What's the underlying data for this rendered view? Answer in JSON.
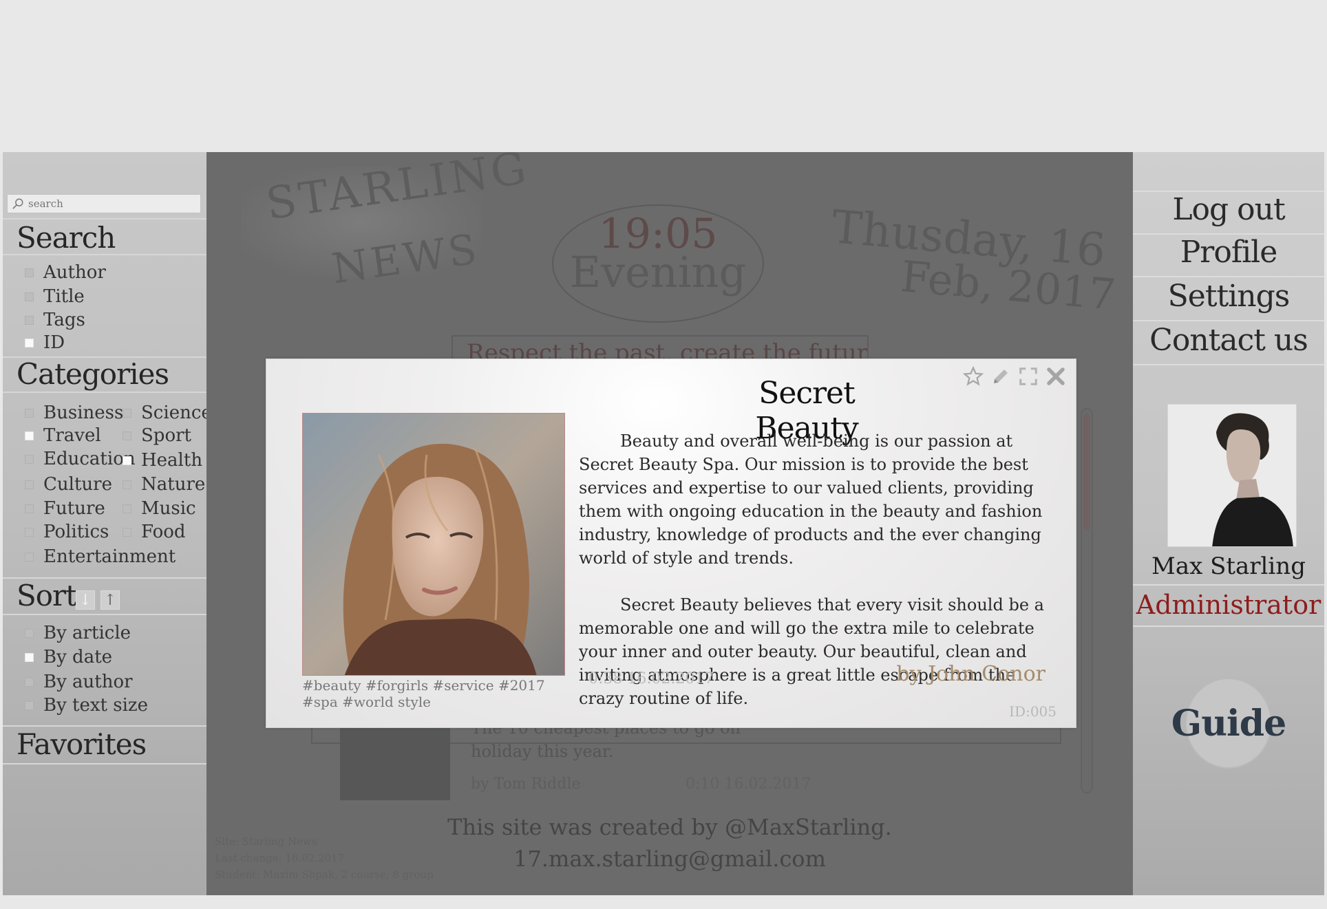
{
  "search": {
    "placeholder": "search"
  },
  "sidebar": {
    "search_title": "Search",
    "search_options": [
      {
        "label": "Author",
        "checked": false
      },
      {
        "label": "Title",
        "checked": false
      },
      {
        "label": "Tags",
        "checked": false
      },
      {
        "label": "ID",
        "checked": true
      }
    ],
    "categories_title": "Categories",
    "categories_left": [
      {
        "label": "Business",
        "checked": false
      },
      {
        "label": "Travel",
        "checked": true
      },
      {
        "label": "Education",
        "checked": false
      },
      {
        "label": "Culture",
        "checked": false
      },
      {
        "label": "Future",
        "checked": false
      },
      {
        "label": "Politics",
        "checked": false
      },
      {
        "label": "Entertainment",
        "checked": false
      }
    ],
    "categories_right": [
      {
        "label": "Science",
        "checked": false
      },
      {
        "label": "Sport",
        "checked": false
      },
      {
        "label": "Health",
        "checked": true
      },
      {
        "label": "Nature",
        "checked": false
      },
      {
        "label": "Music",
        "checked": false
      },
      {
        "label": "Food",
        "checked": false
      }
    ],
    "sort_title": "Sort",
    "sort_options": [
      {
        "label": "By article",
        "checked": false
      },
      {
        "label": "By date",
        "checked": true
      },
      {
        "label": "By author",
        "checked": false
      },
      {
        "label": "By text size",
        "checked": false
      }
    ],
    "favorites_title": "Favorites"
  },
  "header": {
    "logo_line1": "STARLING",
    "logo_line2": "NEWS",
    "time": "19:05",
    "day_part": "Evening",
    "date_line1": "Thusday, 16",
    "date_line2": "Feb, 2017",
    "motto": "Respect the past, create the future!"
  },
  "feed_peek": {
    "text_line1": "The 10 cheapest places to go on",
    "text_line2": "holiday this year.",
    "author": "by Tom Riddle",
    "date": "0:10 16.02.2017"
  },
  "footer": {
    "line1": "This site was created by @MaxStarling.",
    "line2": "17.max.starling@gmail.com",
    "fine1": "Site: Starling News",
    "fine2": "Last change: 16.02.2017",
    "fine3": "Student: Maxim Shpak, 2 course, 8 group"
  },
  "nav": {
    "logout": "Log out",
    "profile": "Profile",
    "settings": "Settings",
    "contact": "Contact us",
    "guide": "Guide"
  },
  "user": {
    "name": "Max  Starling",
    "role": "Administrator"
  },
  "modal": {
    "title": "Secret Beauty",
    "paragraph1": "Beauty and overall well-being is our passion at Secret Beauty Spa.  Our mission is to provide the best services and expertise to our valued clients, providing them with ongoing education in the beauty and fashion industry, knowledge of products and the ever changing world of style and trends.",
    "paragraph2": "Secret Beauty believes that every visit should be a memorable one and will go the extra mile to celebrate your inner and outer beauty.  Our beautiful, clean and inviting atmosphere is a great little escape from the crazy routine of life.",
    "tags": "#beauty #forgirls #service #2017 #spa #world style",
    "date": "0:38 16.02.2017",
    "author": "by John Conor",
    "id": "ID:005"
  },
  "colors": {
    "role": "#8e1c1c",
    "author": "#a58b6b",
    "dim": "#6b6b6b"
  }
}
